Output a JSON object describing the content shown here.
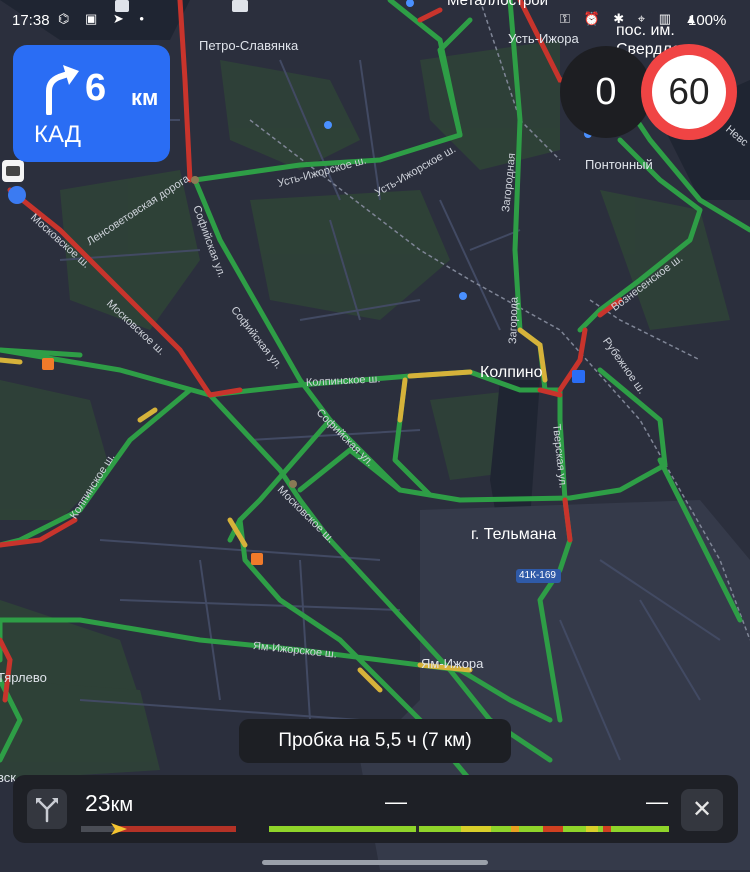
{
  "status_bar": {
    "time": "17:38",
    "left_icons": [
      "vpn-icon",
      "photo-icon",
      "send-icon",
      "dot-icon"
    ],
    "right_icons": [
      "key-icon",
      "alarm-icon",
      "bluetooth-icon",
      "location-icon",
      "volte-icon",
      "4g-icon",
      "signal-icon"
    ],
    "left_glyphs": "⌬ ▣ ➤ •",
    "right_glyphs": "⚿ ⏰ ✱ ⌖ ▥ ▲",
    "battery": "100%"
  },
  "maneuver": {
    "distance": "6",
    "unit": "км",
    "road": "КАД",
    "icon": "turn-right-arrow-icon",
    "color": "#2a6df4"
  },
  "speed": {
    "current": "0",
    "limit": "60",
    "limit_border_color": "#f04444"
  },
  "map_labels": {
    "metallostroy": "Металлострой",
    "ust_izhora": "Усть-Ижора",
    "pos_im": "пос. им.",
    "sverdlova": "Свердлова",
    "petro_slavyanka": "Петро-Славянка",
    "pontonny": "Понтонный",
    "nevskaya": "Невс",
    "kolpino": "Колпино",
    "tel_mana": "г. Тельмана",
    "road_41k": "41К-169",
    "yam_izhora": "Ям-Ижора",
    "tyarlevo": "Тярлево",
    "vsk": "вск",
    "lensovetovskaya": "Ленсоветовская дорога",
    "moskovskoe1": "Московское ш.",
    "moskovskoe2": "Московское ш.",
    "moskovskoe3": "Московское ш.",
    "sofiyskaya1": "Софийская ул.",
    "sofiyskaya2": "Софийская ул.",
    "sofiyskaya3": "Софийская ул.",
    "ust_izhorskoe1": "Усть-Ижорское ш.",
    "ust_izhorskoe2": "Усть-Ижорское ш.",
    "kolpinskoe1": "Колпинское ш.",
    "kolpinskoe2": "Колпинское ш.",
    "zagorodnaya": "Загородная",
    "zagorodnaya2": "Загорода",
    "voznesenskoe": "Вознесенское ш.",
    "rubezhnoe": "Рубежное ш.",
    "tverskaya": "Тверская ул.",
    "yam_izhorskoe": "Ям-Ижорское ш."
  },
  "traffic_banner": "Пробка на 5,5 ч (7 км)",
  "bottom_panel": {
    "distance": "23",
    "unit": "км",
    "eta_placeholder": "—",
    "time_placeholder": "—",
    "close_label": "✕",
    "progress_passed_fraction": 0.27
  },
  "colors": {
    "map_bg": "#2b2f3d",
    "road_green": "#2e9e46",
    "road_yellow": "#d6b23a",
    "road_red": "#c8342c",
    "forest": "#2e4638"
  }
}
